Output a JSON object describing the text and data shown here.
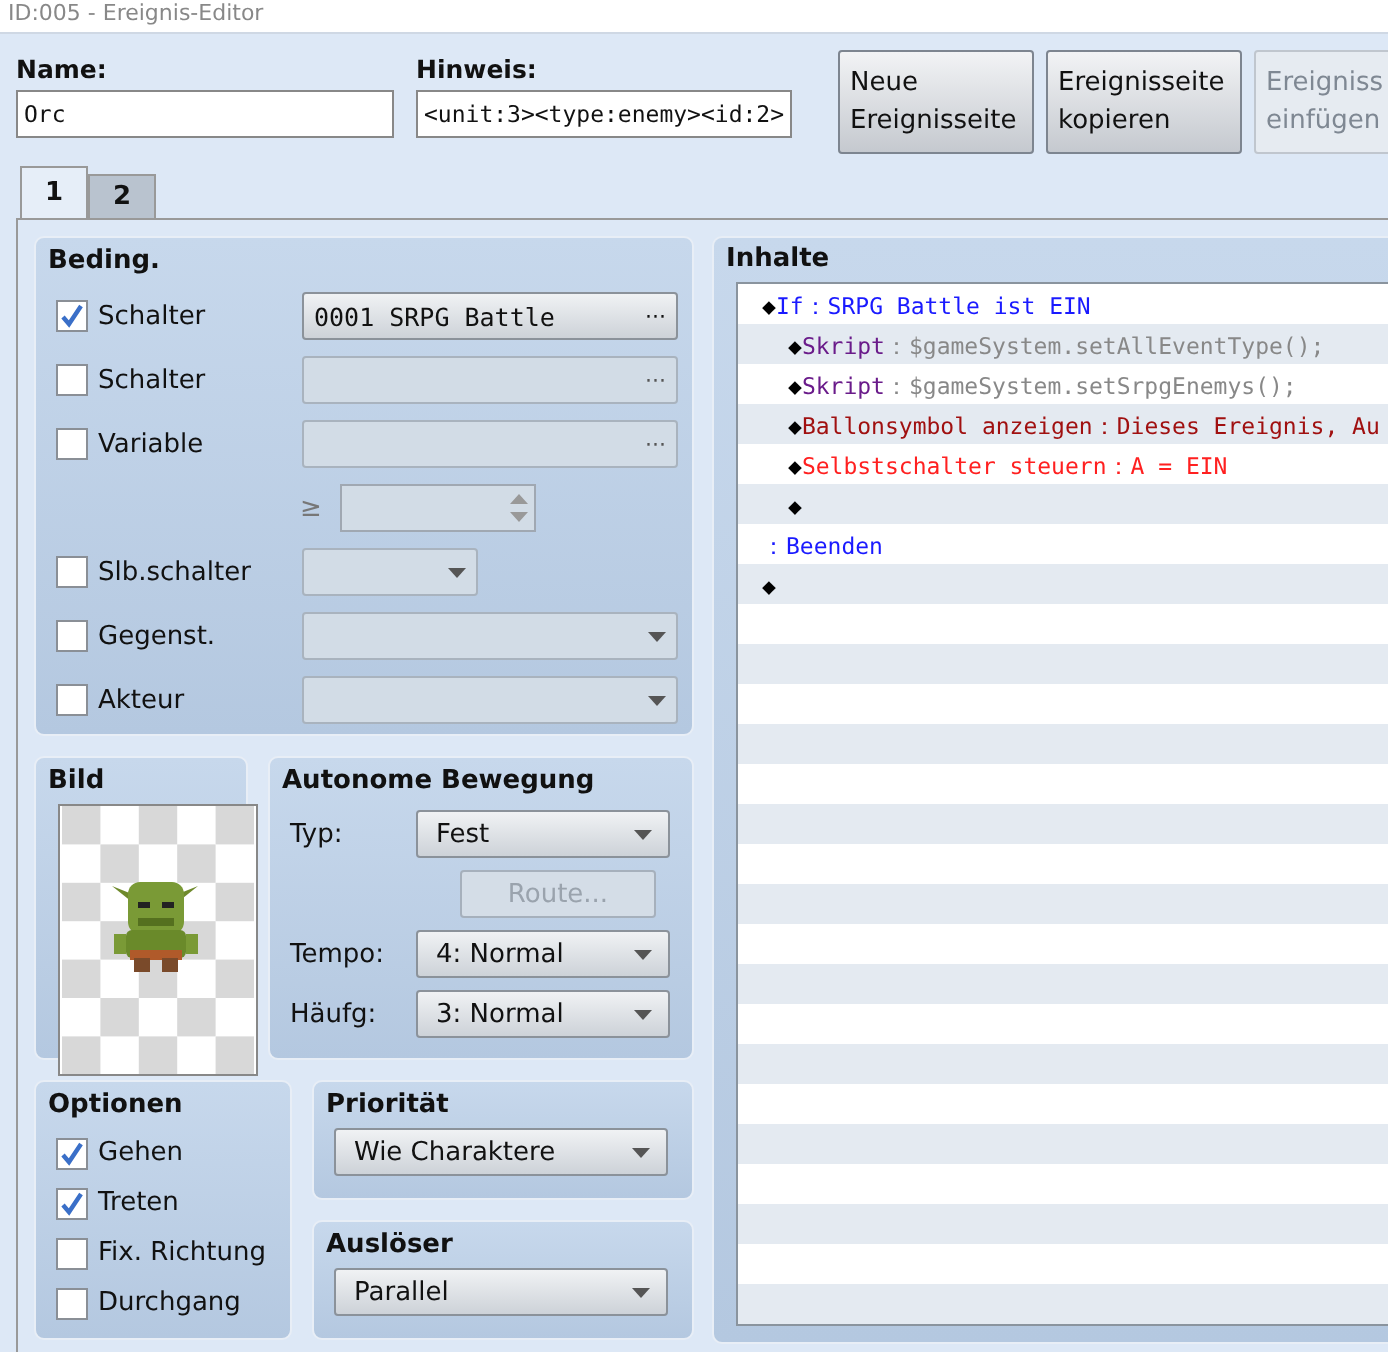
{
  "window": {
    "title": "ID:005 - Ereignis-Editor"
  },
  "name_field": {
    "label": "Name:",
    "value": "Orc"
  },
  "note_field": {
    "label": "Hinweis:",
    "value": "<unit:3><type:enemy><id:2>"
  },
  "buttons": [
    {
      "lines": [
        "Neue",
        "Ereignisseite"
      ],
      "disabled": false
    },
    {
      "lines": [
        "Ereignisseite",
        "kopieren"
      ],
      "disabled": false
    },
    {
      "lines": [
        "Ereigniss",
        "einfügen"
      ],
      "disabled": true
    }
  ],
  "tabs": [
    {
      "label": "1",
      "selected": true
    },
    {
      "label": "2",
      "selected": false
    }
  ],
  "conditions": {
    "title": "Beding.",
    "items": [
      {
        "kind": "picker",
        "label": "Schalter",
        "checked": true,
        "value": "0001 SRPG Battle",
        "button": "···"
      },
      {
        "kind": "picker",
        "label": "Schalter",
        "checked": false,
        "button": "···"
      },
      {
        "kind": "picker",
        "label": "Variable",
        "checked": false,
        "button": "···"
      },
      {
        "kind": "spin",
        "symbol": "≥",
        "checked": false
      },
      {
        "kind": "select",
        "label": "Slb.schalter",
        "checked": false,
        "narrow": true
      },
      {
        "kind": "select",
        "label": "Gegenst.",
        "checked": false
      },
      {
        "kind": "select",
        "label": "Akteur",
        "checked": false
      }
    ]
  },
  "image": {
    "title": "Bild"
  },
  "movement": {
    "title": "Autonome Bewegung",
    "type": {
      "label": "Typ:",
      "value": "Fest"
    },
    "route_button": {
      "label": "Route...",
      "disabled": true
    },
    "speed": {
      "label": "Tempo:",
      "value": "4: Normal"
    },
    "frequency": {
      "label": "Häufg:",
      "value": "3: Normal"
    }
  },
  "options": {
    "title": "Optionen",
    "items": [
      {
        "label": "Gehen",
        "checked": true
      },
      {
        "label": "Treten",
        "checked": true
      },
      {
        "label": "Fix. Richtung",
        "checked": false
      },
      {
        "label": "Durchgang",
        "checked": false
      }
    ]
  },
  "priority": {
    "title": "Priorität",
    "value": "Wie Charaktere"
  },
  "trigger": {
    "title": "Auslöser",
    "value": "Parallel"
  },
  "contents": {
    "title": "Inhalte",
    "lines": [
      {
        "kind": "flow",
        "marker": "◆",
        "command": "If",
        "separator": "：",
        "args": "SRPG Battle ist EIN",
        "children": [
          {
            "kind": "script",
            "marker": "◆",
            "command": "Skript",
            "separator": "：",
            "args": "$gameSystem.setAllEventType();"
          },
          {
            "kind": "script",
            "marker": "◆",
            "command": "Skript",
            "separator": "：",
            "args": "$gameSystem.setSrpgEnemys();"
          },
          {
            "kind": "balloon",
            "marker": "◆",
            "command": "Ballonsymbol anzeigen",
            "separator": "：",
            "args": "Dieses Ereignis, Au"
          },
          {
            "kind": "switch",
            "marker": "◆",
            "command": "Selbstschalter steuern",
            "separator": "：",
            "args": "A = EIN"
          },
          {
            "kind": "empty",
            "marker": "◆"
          }
        ]
      },
      {
        "kind": "flow",
        "separator": "：",
        "command": "Beenden"
      },
      {
        "kind": "empty",
        "marker": "◆"
      }
    ]
  }
}
